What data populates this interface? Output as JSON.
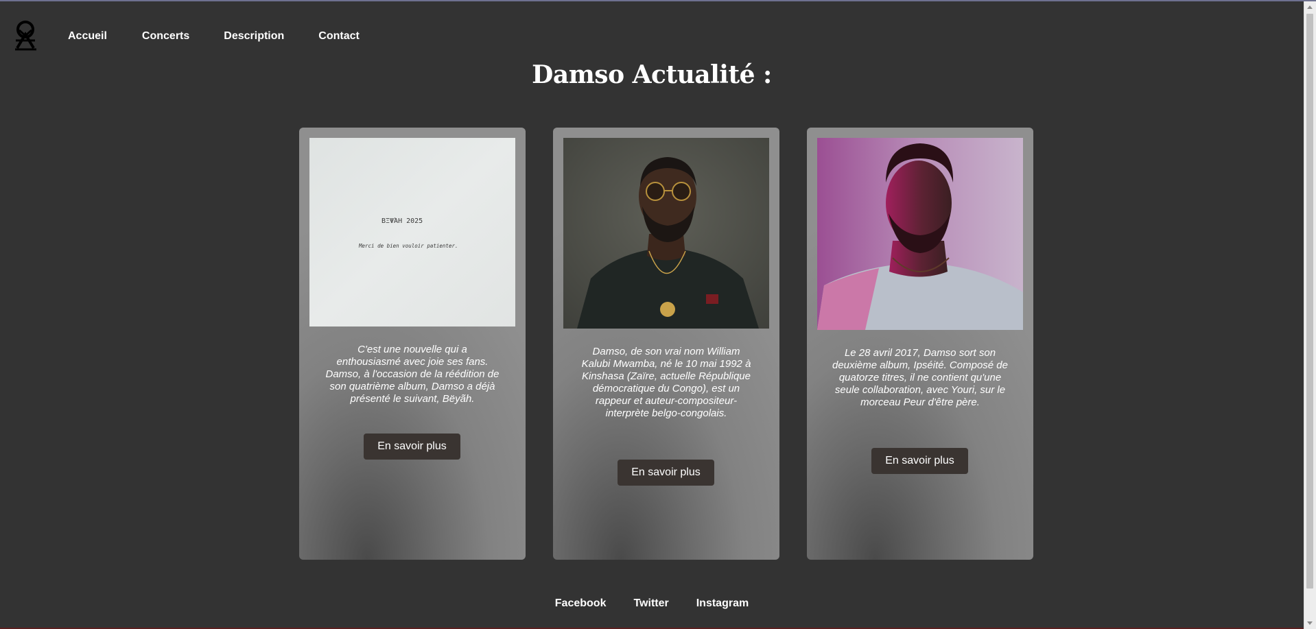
{
  "nav": {
    "logo_icon": "damso-logo-icon",
    "items": [
      {
        "label": "Accueil"
      },
      {
        "label": "Concerts"
      },
      {
        "label": "Description"
      },
      {
        "label": "Contact"
      }
    ]
  },
  "page": {
    "title": "Damso Actualité :"
  },
  "cards": [
    {
      "image": "handwritten-note-image",
      "image_text_line1": "ΒΞΨΆΗ 2025",
      "image_text_line2": "Merci de bien vouloir patienter.",
      "text": "C'est une nouvelle qui a enthousiasmé avec joie ses fans. Damso, à l'occasion de la réédition de son quatrième album, Damso a déjà présenté le suivant, Bëyãh.",
      "button": "En savoir plus"
    },
    {
      "image": "damso-portrait-sunglasses-image",
      "text": "Damso, de son vrai nom William Kalubi Mwamba, né le 10 mai 1992 à Kinshasa (Zaïre, actuelle République démocratique du Congo), est un rappeur et auteur-compositeur-interprète belgo-congolais.",
      "button": "En savoir plus"
    },
    {
      "image": "damso-portrait-purple-light-image",
      "text": "Le 28 avril 2017, Damso sort son deuxième album, Ipséité. Composé de quatorze titres, il ne contient qu'une seule collaboration, avec Youri, sur le morceau Peur d'être père.",
      "button": "En savoir plus"
    }
  ],
  "footer": {
    "links": [
      {
        "label": "Facebook"
      },
      {
        "label": "Twitter"
      },
      {
        "label": "Instagram"
      }
    ]
  },
  "colors": {
    "background": "#333333",
    "card_button": "#3a3431",
    "text": "#ffffff"
  }
}
